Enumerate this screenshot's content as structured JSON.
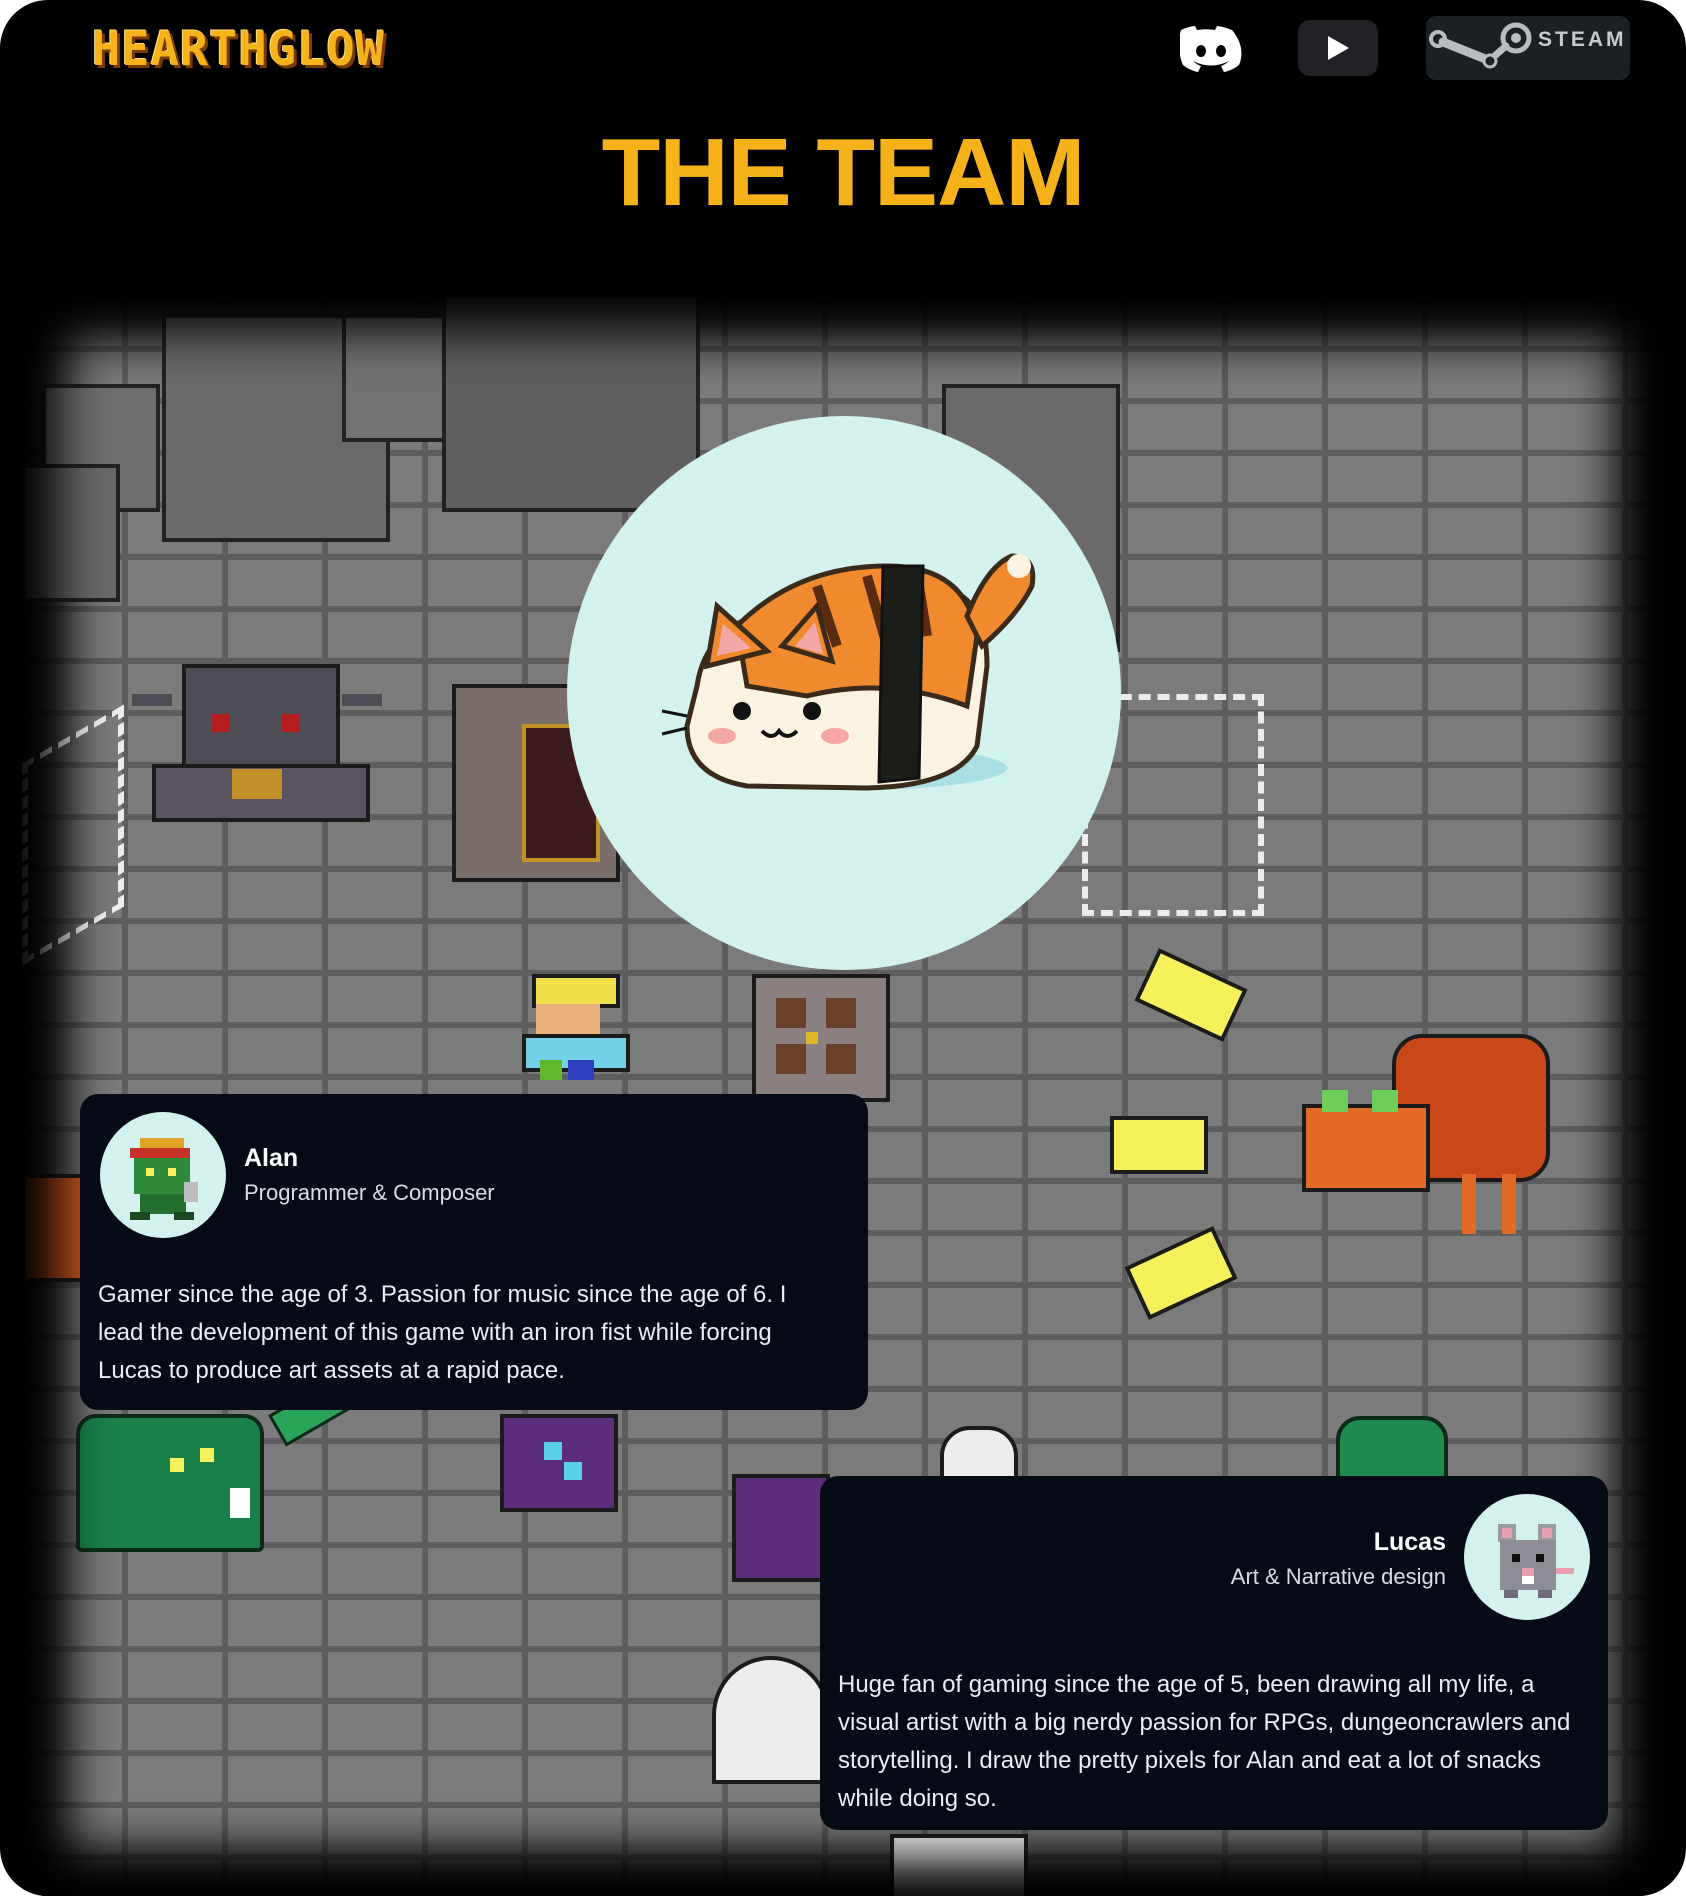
{
  "header": {
    "logo_text": "HEARTHGLOW",
    "nav": [
      {
        "name": "Discord",
        "icon": "discord-icon"
      },
      {
        "name": "YouTube",
        "icon": "play-icon"
      },
      {
        "name": "Steam",
        "icon": "steam-icon",
        "label": "STEAM"
      }
    ]
  },
  "page": {
    "title": "THE TEAM",
    "featured_avatar": "sushi-cat-avatar"
  },
  "team": [
    {
      "name": "Alan",
      "role": "Programmer & Composer",
      "bio": "Gamer since the age of 3. Passion for music since the age of 6. I lead the development of this game with an iron fist while forcing Lucas to produce art assets at a rapid pace.",
      "avatar": "pixel-goblin-avatar"
    },
    {
      "name": "Lucas",
      "role": "Art & Narrative design",
      "bio": "Huge fan of gaming since the age of 5, been drawing all my life, a visual artist with a big nerdy passion for RPGs, dungeoncrawlers and storytelling. I draw the pretty pixels for Alan and eat a lot of snacks while doing so.",
      "avatar": "pixel-rat-avatar"
    }
  ],
  "colors": {
    "accent": "#f6b21b",
    "card_bg": "#070b16",
    "avatar_bg": "#d3f1ed",
    "brick": "#7b7b7b",
    "mortar": "#5e5e5e"
  }
}
